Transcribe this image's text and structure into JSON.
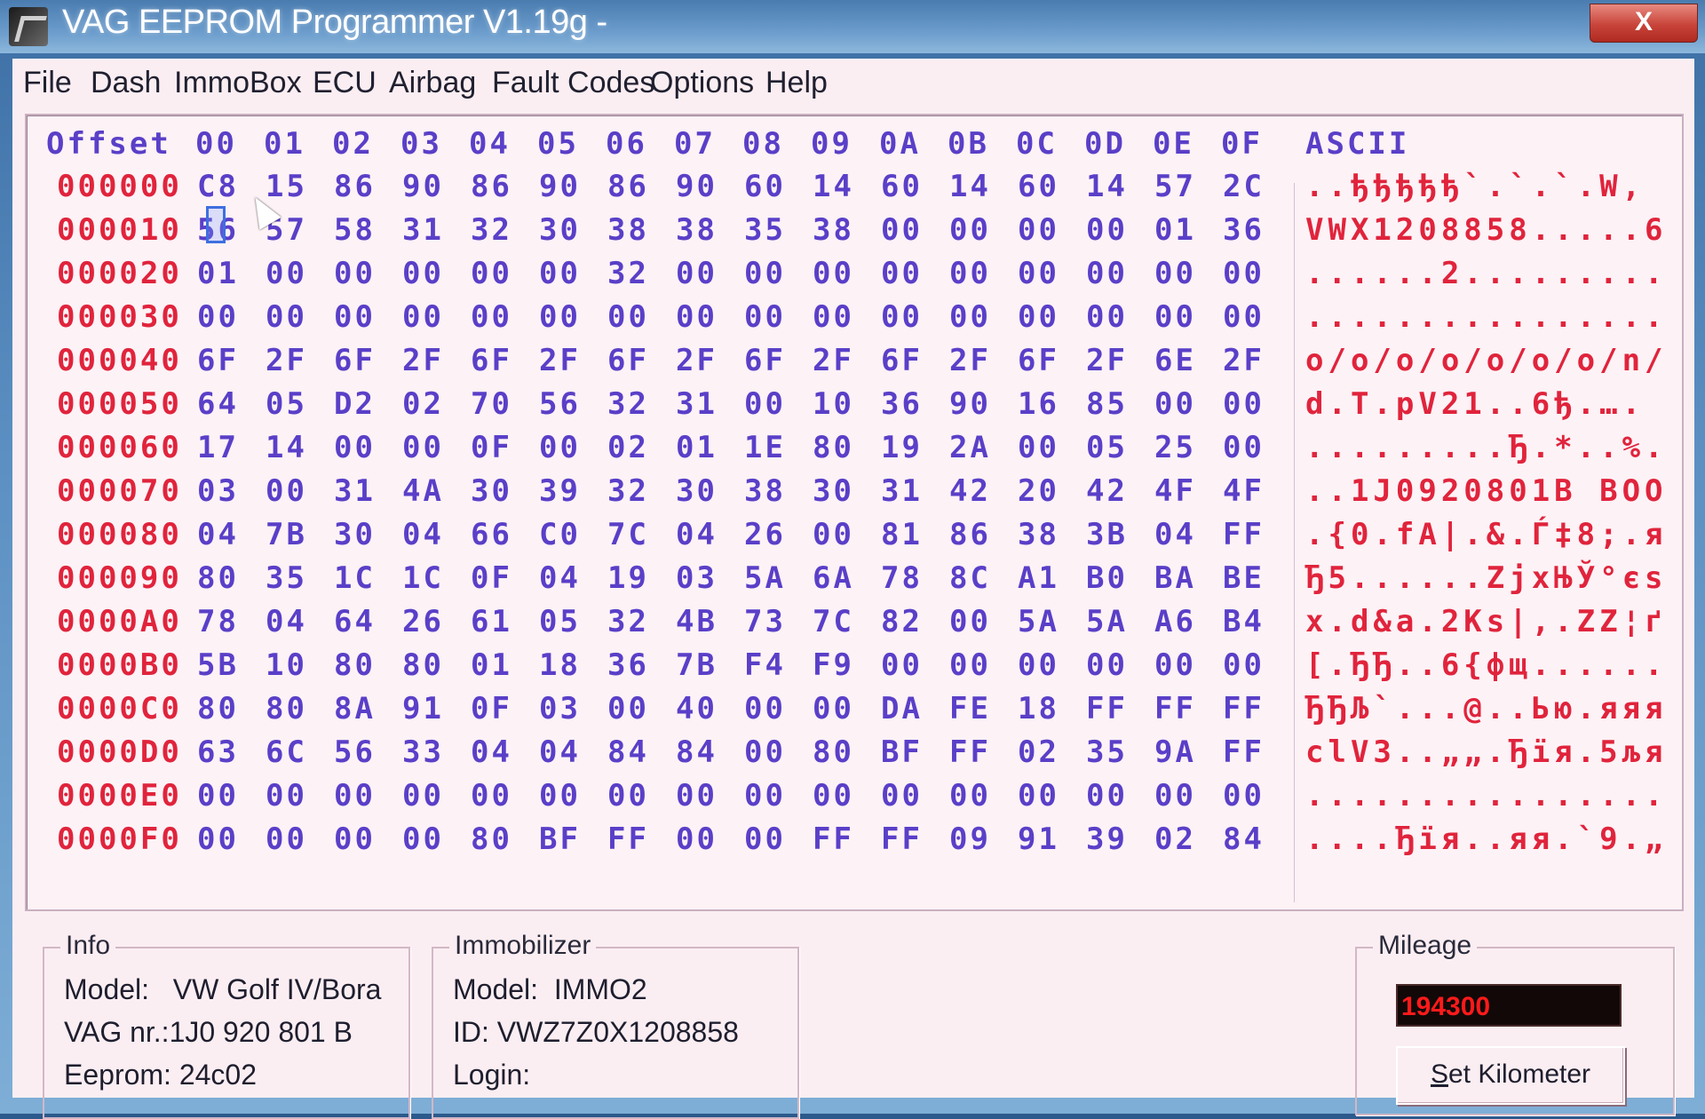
{
  "window": {
    "title": "VAG EEPROM Programmer  V1.19g -",
    "close_label": "X"
  },
  "menu": [
    "File",
    "Dash",
    "ImmoBox",
    "ECU",
    "Airbag",
    "Fault Codes",
    "Options",
    "Help"
  ],
  "hex_view": {
    "offset_header": "Offset",
    "column_headers": [
      "00",
      "01",
      "02",
      "03",
      "04",
      "05",
      "06",
      "07",
      "08",
      "09",
      "0A",
      "0B",
      "0C",
      "0D",
      "0E",
      "0F"
    ],
    "ascii_header": "ASCII",
    "rows": [
      {
        "offset": "000000",
        "bytes": [
          "C8",
          "15",
          "86",
          "90",
          "86",
          "90",
          "86",
          "90",
          "60",
          "14",
          "60",
          "14",
          "60",
          "14",
          "57",
          "2C"
        ],
        "ascii": "..ђђђђђ`.`.`.W,"
      },
      {
        "offset": "000010",
        "bytes": [
          "56",
          "57",
          "58",
          "31",
          "32",
          "30",
          "38",
          "38",
          "35",
          "38",
          "00",
          "00",
          "00",
          "00",
          "01",
          "36"
        ],
        "ascii": "VWX1208858.....6"
      },
      {
        "offset": "000020",
        "bytes": [
          "01",
          "00",
          "00",
          "00",
          "00",
          "00",
          "32",
          "00",
          "00",
          "00",
          "00",
          "00",
          "00",
          "00",
          "00",
          "00"
        ],
        "ascii": "......2........."
      },
      {
        "offset": "000030",
        "bytes": [
          "00",
          "00",
          "00",
          "00",
          "00",
          "00",
          "00",
          "00",
          "00",
          "00",
          "00",
          "00",
          "00",
          "00",
          "00",
          "00"
        ],
        "ascii": "................"
      },
      {
        "offset": "000040",
        "bytes": [
          "6F",
          "2F",
          "6F",
          "2F",
          "6F",
          "2F",
          "6F",
          "2F",
          "6F",
          "2F",
          "6F",
          "2F",
          "6F",
          "2F",
          "6E",
          "2F"
        ],
        "ascii": "o/o/o/o/o/o/o/n/"
      },
      {
        "offset": "000050",
        "bytes": [
          "64",
          "05",
          "D2",
          "02",
          "70",
          "56",
          "32",
          "31",
          "00",
          "10",
          "36",
          "90",
          "16",
          "85",
          "00",
          "00"
        ],
        "ascii": "d.T.pV21..6ђ.…."
      },
      {
        "offset": "000060",
        "bytes": [
          "17",
          "14",
          "00",
          "00",
          "0F",
          "00",
          "02",
          "01",
          "1E",
          "80",
          "19",
          "2A",
          "00",
          "05",
          "25",
          "00"
        ],
        "ascii": ".........Ђ.*..%."
      },
      {
        "offset": "000070",
        "bytes": [
          "03",
          "00",
          "31",
          "4A",
          "30",
          "39",
          "32",
          "30",
          "38",
          "30",
          "31",
          "42",
          "20",
          "42",
          "4F",
          "4F"
        ],
        "ascii": "..1J0920801B BOO"
      },
      {
        "offset": "000080",
        "bytes": [
          "04",
          "7B",
          "30",
          "04",
          "66",
          "C0",
          "7C",
          "04",
          "26",
          "00",
          "81",
          "86",
          "38",
          "3B",
          "04",
          "FF"
        ],
        "ascii": ".{0.fA|.&.Ѓ‡8;.я"
      },
      {
        "offset": "000090",
        "bytes": [
          "80",
          "35",
          "1C",
          "1C",
          "0F",
          "04",
          "19",
          "03",
          "5A",
          "6A",
          "78",
          "8C",
          "A1",
          "B0",
          "BA",
          "BE"
        ],
        "ascii": "Ђ5......ZjxЊЎ°єѕ"
      },
      {
        "offset": "0000A0",
        "bytes": [
          "78",
          "04",
          "64",
          "26",
          "61",
          "05",
          "32",
          "4B",
          "73",
          "7C",
          "82",
          "00",
          "5A",
          "5A",
          "A6",
          "B4"
        ],
        "ascii": "x.d&a.2Ks|‚.ZZ¦ґ"
      },
      {
        "offset": "0000B0",
        "bytes": [
          "5B",
          "10",
          "80",
          "80",
          "01",
          "18",
          "36",
          "7B",
          "F4",
          "F9",
          "00",
          "00",
          "00",
          "00",
          "00",
          "00"
        ],
        "ascii": "[.ЂЂ..6{фщ......"
      },
      {
        "offset": "0000C0",
        "bytes": [
          "80",
          "80",
          "8A",
          "91",
          "0F",
          "03",
          "00",
          "40",
          "00",
          "00",
          "DA",
          "FE",
          "18",
          "FF",
          "FF",
          "FF"
        ],
        "ascii": "ЂЂЉ`...@..Ью.яяя"
      },
      {
        "offset": "0000D0",
        "bytes": [
          "63",
          "6C",
          "56",
          "33",
          "04",
          "04",
          "84",
          "84",
          "00",
          "80",
          "BF",
          "FF",
          "02",
          "35",
          "9A",
          "FF"
        ],
        "ascii": "clV3..„„.Ђїя.5љя"
      },
      {
        "offset": "0000E0",
        "bytes": [
          "00",
          "00",
          "00",
          "00",
          "00",
          "00",
          "00",
          "00",
          "00",
          "00",
          "00",
          "00",
          "00",
          "00",
          "00",
          "00"
        ],
        "ascii": "................"
      },
      {
        "offset": "0000F0",
        "bytes": [
          "00",
          "00",
          "00",
          "00",
          "80",
          "BF",
          "FF",
          "00",
          "00",
          "FF",
          "FF",
          "09",
          "91",
          "39",
          "02",
          "84"
        ],
        "ascii": "....Ђїя..яя.`9.„"
      }
    ]
  },
  "info": {
    "title": "Info",
    "model": "Model:   VW Golf IV/Bora",
    "vag_nr": "VAG nr.:1J0 920 801 B",
    "eeprom": "Eeprom: 24c02"
  },
  "immobilizer": {
    "title": "Immobilizer",
    "model": "Model:  IMMO2",
    "id": "ID: VWZ7Z0X1208858",
    "login": "Login:"
  },
  "mileage": {
    "title": "Mileage",
    "value": "194300",
    "button_underlined": "S",
    "button_rest": "et Kilometer"
  },
  "colors": {
    "offset_red": "#e0243c",
    "hex_purple": "#5a3fc8",
    "client_pink": "#fbeef2",
    "mileage_red": "#ff1a1a"
  }
}
